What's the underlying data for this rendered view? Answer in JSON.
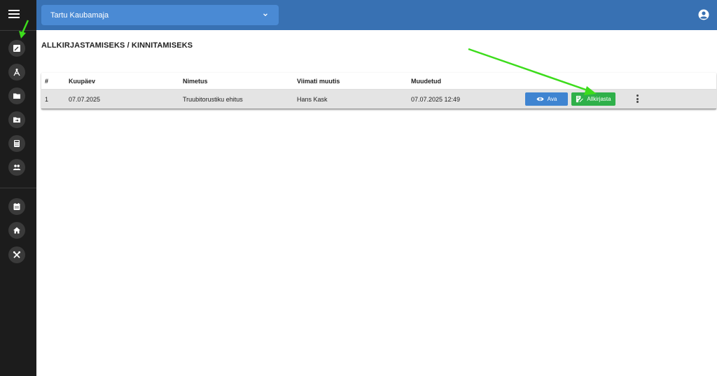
{
  "sidebar": {
    "menu_icon": "hamburger-menu-icon",
    "icons": [
      "signature-icon",
      "drafting-compass-icon",
      "folder-icon",
      "folder-move-icon",
      "calculator-icon",
      "users-icon",
      "calendar-icon",
      "home-icon",
      "tools-icon"
    ]
  },
  "header": {
    "organization": "Tartu Kaubamaja",
    "user_icon": "account-circle-icon"
  },
  "page": {
    "title": "ALLKIRJASTAMISEKS / KINNITAMISEKS"
  },
  "table": {
    "columns": [
      "#",
      "Kuupäev",
      "Nimetus",
      "Viimati muutis",
      "Muudetud"
    ],
    "rows": [
      {
        "num": "1",
        "date": "07.07.2025",
        "name": "Truubitorustiku ehitus",
        "modified_by": "Hans Kask",
        "modified": "07.07.2025 12:49"
      }
    ],
    "actions": {
      "open_label": "Ava",
      "sign_label": "Allkirjasta"
    }
  },
  "annotations": {
    "arrow_color": "#3ddc1c"
  },
  "colors": {
    "sidebar": "#1c1c1c",
    "topbar": "#3871b3",
    "select": "#4a8ad4",
    "open_button": "#3f84d1",
    "sign_button": "#2fb04a"
  }
}
